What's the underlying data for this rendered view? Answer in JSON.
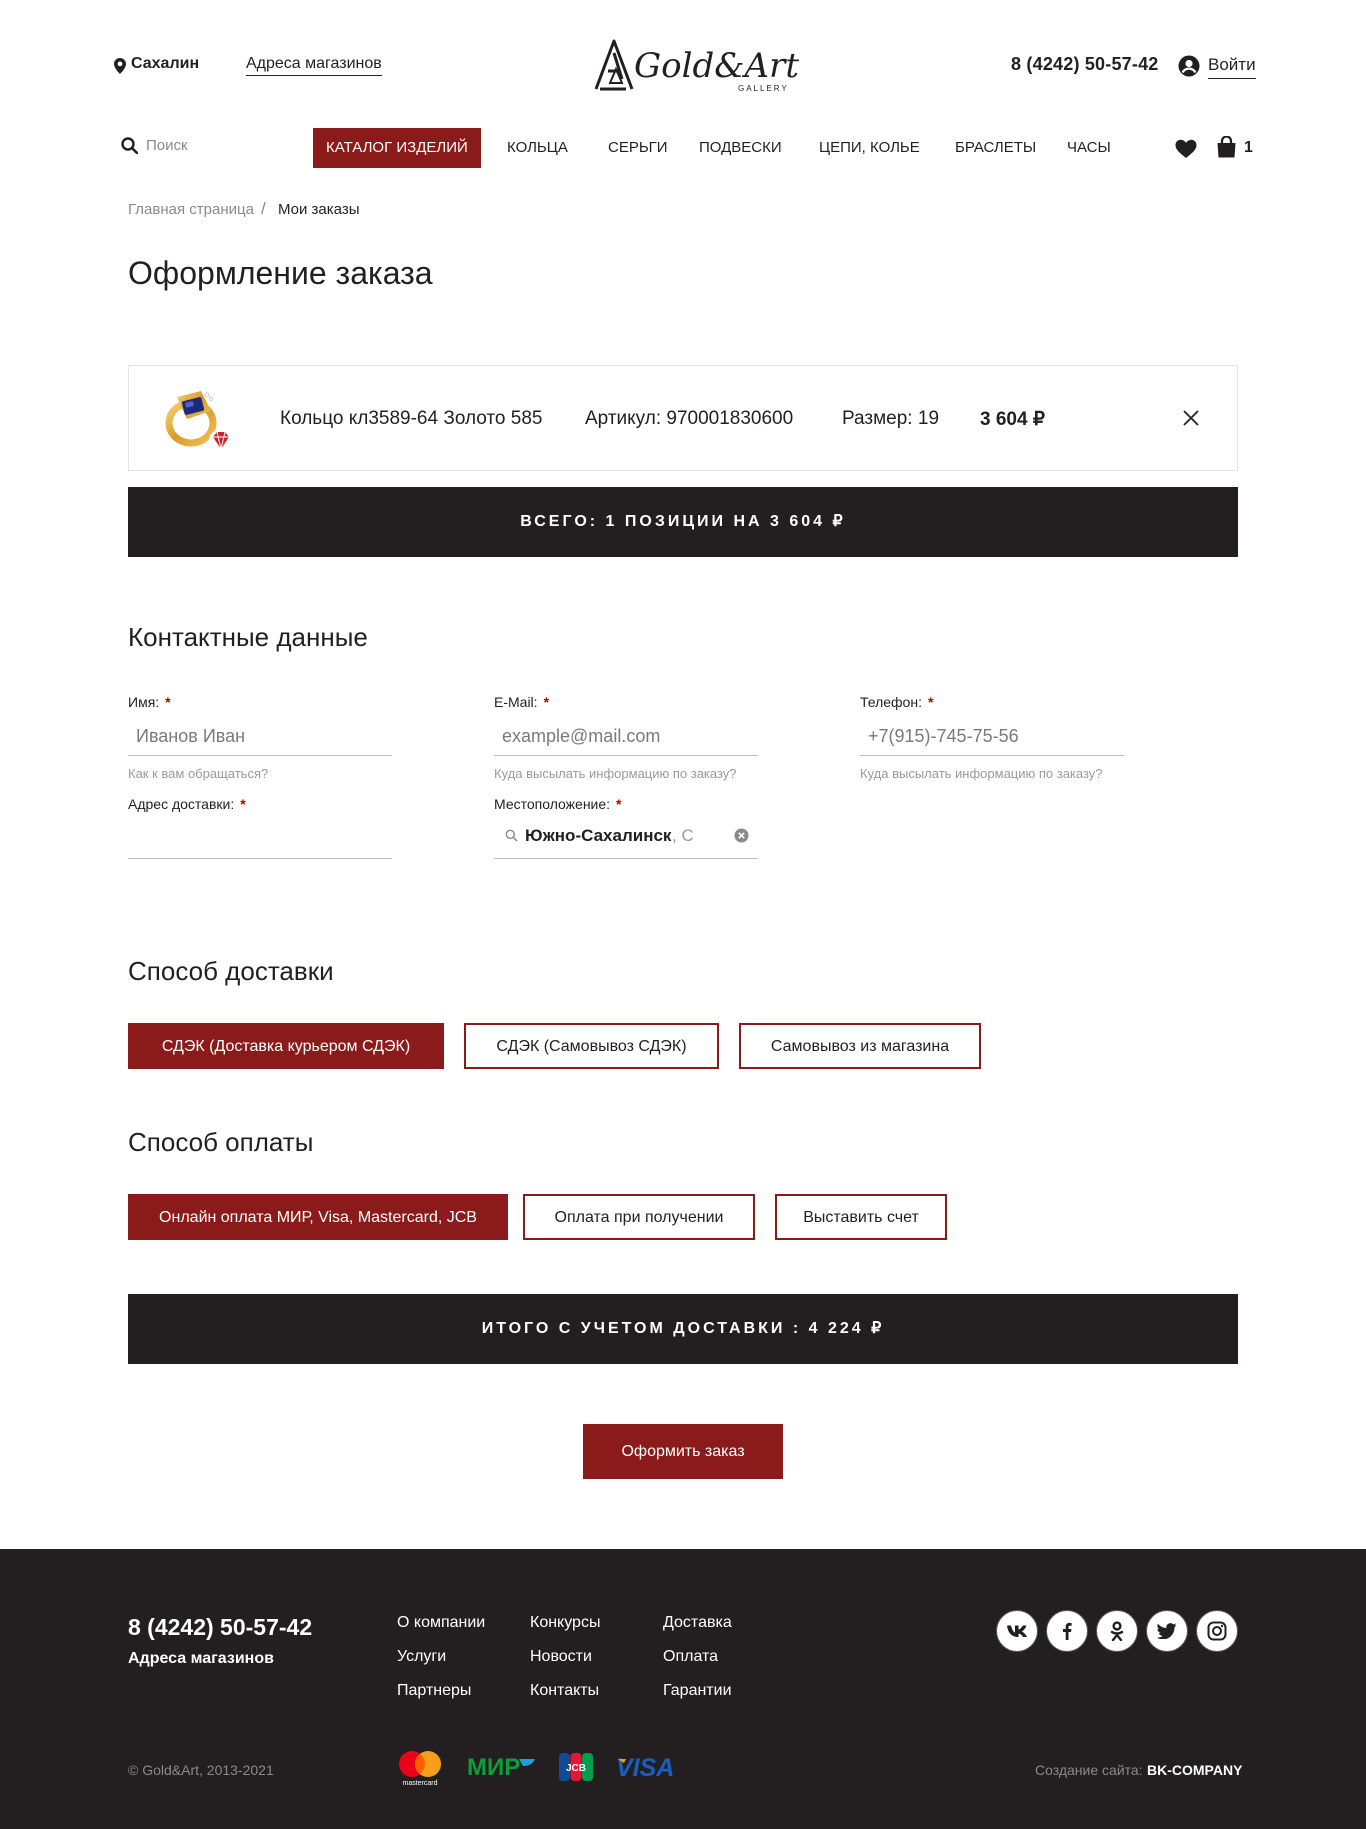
{
  "header": {
    "city": "Сахалин",
    "stores_link": "Адреса магазинов",
    "logo_text": "Gold&Art",
    "logo_sub": "GALLERY",
    "phone": "8 (4242) 50-57-42",
    "login": "Войти",
    "search_placeholder": "Поиск",
    "cart_count": "1"
  },
  "nav": {
    "items": [
      "КАТАЛОГ ИЗДЕЛИЙ",
      "КОЛЬЦА",
      "СЕРЬГИ",
      "ПОДВЕСКИ",
      "ЦЕПИ, КОЛЬЕ",
      "БРАСЛЕТЫ",
      "ЧАСЫ"
    ],
    "active": "КАТАЛОГ ИЗДЕЛИЙ"
  },
  "breadcrumb": {
    "home": "Главная страница",
    "separator": "/",
    "current": "Мои заказы"
  },
  "page_title": "Оформление заказа",
  "cart": {
    "item": {
      "name": "Кольцо кл3589-64 Золото 585",
      "sku": "Артикул: 970001830600",
      "size_label": "Размер:",
      "size_value": "19",
      "price": "3 604 ₽"
    },
    "total_bar": "ВСЕГО: 1 ПОЗИЦИИ НА 3 604 ₽"
  },
  "contacts": {
    "title": "Контактные данные",
    "name": {
      "label": "Имя:",
      "placeholder": "Иванов Иван",
      "hint": "Как к вам обращаться?"
    },
    "email": {
      "label": "E-Mail:",
      "placeholder": "example@mail.com",
      "hint": "Куда высылать информацию по заказу?"
    },
    "phone": {
      "label": "Телефон:",
      "placeholder": "+7(915)-745-75-56",
      "hint": "Куда высылать информацию по заказу?"
    },
    "address": {
      "label": "Адрес доставки:",
      "value": ""
    },
    "location": {
      "label": "Местоположение:",
      "value": "Южно-Сахалинск",
      "tail": ", С"
    },
    "required_mark": "*"
  },
  "delivery": {
    "title": "Способ доставки",
    "options": [
      "СДЭК (Доставка курьером СДЭК)",
      "СДЭК (Самовывоз СДЭК)",
      "Самовывоз из магазина"
    ],
    "selected": "СДЭК (Доставка курьером СДЭК)"
  },
  "payment": {
    "title": "Способ оплаты",
    "options": [
      "Онлайн оплата МИР, Visa, Mastercard, JCB",
      "Оплата при получении",
      "Выставить счет"
    ],
    "selected": "Онлайн оплата МИР, Visa, Mastercard, JCB"
  },
  "grand_total_bar": "ИТОГО С УЧЕТОМ ДОСТАВКИ : 4 224 ₽",
  "submit_label": "Оформить заказ",
  "footer": {
    "phone": "8 (4242) 50-57-42",
    "stores": "Адреса магазинов",
    "links_col1": [
      "О компании",
      "Услуги",
      "Партнеры"
    ],
    "links_col2": [
      "Конкурсы",
      "Новости",
      "Контакты"
    ],
    "links_col3": [
      "Доставка",
      "Оплата",
      "Гарантии"
    ],
    "social": [
      "vk-icon",
      "facebook-icon",
      "odnoklassniki-icon",
      "twitter-icon",
      "instagram-icon"
    ],
    "copyright": "© Gold&Art, 2013-2021",
    "payment_logos": {
      "mastercard": "mastercard",
      "mir": "МИР",
      "jcb": "JCB",
      "visa": "VISA"
    },
    "dev_label": "Создание сайта:",
    "dev_name": "BK-COMPANY"
  },
  "colors": {
    "accent": "#8b1a1a",
    "dark": "#231f20",
    "muted": "#8a8a8a"
  }
}
